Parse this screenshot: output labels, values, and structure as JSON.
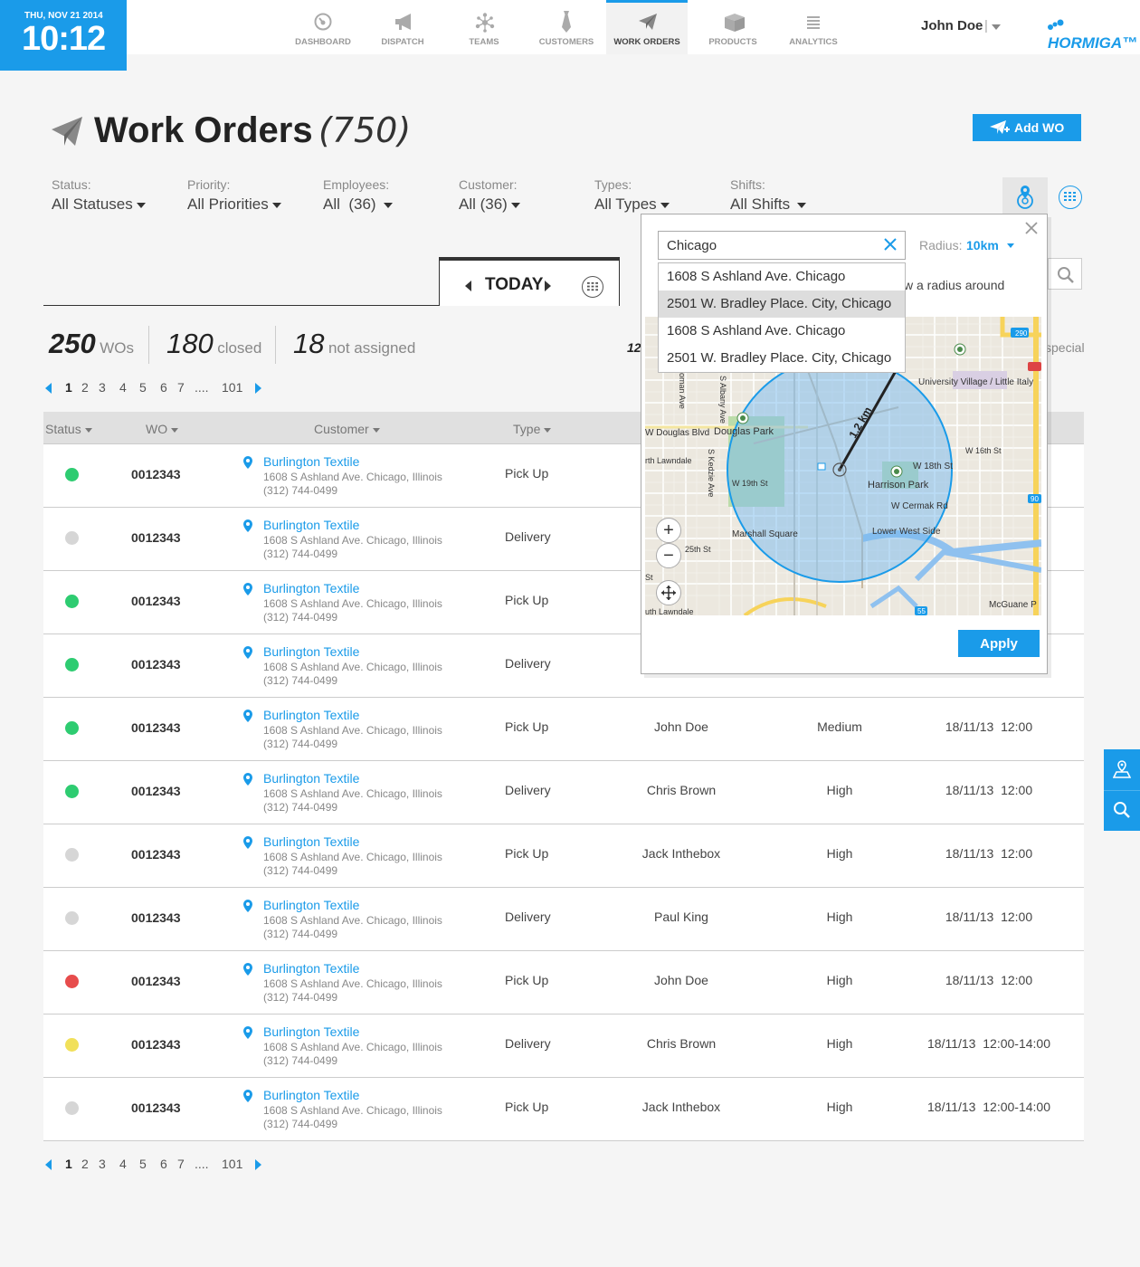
{
  "clock": {
    "date": "THU, NOV 21 2014",
    "time": "10:12"
  },
  "nav": [
    {
      "label": "DASHBOARD",
      "icon": "dashboard-icon"
    },
    {
      "label": "DISPATCH",
      "icon": "megaphone-icon"
    },
    {
      "label": "TEAMS",
      "icon": "teams-icon"
    },
    {
      "label": "CUSTOMERS",
      "icon": "tie-icon"
    },
    {
      "label": "WORK ORDERS",
      "icon": "paper-plane-icon",
      "active": true
    },
    {
      "label": "PRODUCTS",
      "icon": "box-icon"
    },
    {
      "label": "ANALYTICS",
      "icon": "list-icon"
    }
  ],
  "user": {
    "name": "John Doe",
    "separator": "|"
  },
  "brand": {
    "logo": "HORMIGA™",
    "accent": "#1a9be9"
  },
  "page": {
    "title": "Work Orders",
    "count": "(750)",
    "add_label": "Add WO"
  },
  "filters": [
    {
      "label": "Status:",
      "value": "All Statuses"
    },
    {
      "label": "Priority:",
      "value": "All Priorities"
    },
    {
      "label": "Employees:",
      "value": "All  (36)"
    },
    {
      "label": "Customer:",
      "value": "All (36)"
    },
    {
      "label": "Types:",
      "value": "All Types"
    },
    {
      "label": "Shifts:",
      "value": "All Shifts"
    }
  ],
  "day": {
    "label": "TODAY"
  },
  "stats": {
    "wos": "250",
    "wos_label": "WOs",
    "closed": "180",
    "closed_label": "closed",
    "unassigned": "18",
    "unassigned_label": "not assigned",
    "partial_left": "12",
    "partial_right": "special"
  },
  "pager": {
    "pages": [
      "1",
      "2",
      "3",
      "4",
      "5",
      "6",
      "7",
      "....",
      "101"
    ],
    "current": "1"
  },
  "table": {
    "headers": [
      "Status",
      "WO",
      "Customer",
      "Type"
    ],
    "rows": [
      {
        "status": "#2ecc71",
        "wo": "0012343",
        "customer": "Burlington Textile",
        "address": "1608 S Ashland Ave. Chicago, Illinois",
        "phone": "(312) 744-0499",
        "type": "Pick Up",
        "employee": "",
        "priority": "",
        "date": ""
      },
      {
        "status": "#d6d6d6",
        "wo": "0012343",
        "customer": "Burlington Textile",
        "address": "1608 S Ashland Ave. Chicago, Illinois",
        "phone": "(312) 744-0499",
        "type": "Delivery",
        "employee": "",
        "priority": "",
        "date": ""
      },
      {
        "status": "#2ecc71",
        "wo": "0012343",
        "customer": "Burlington Textile",
        "address": "1608 S Ashland Ave. Chicago, Illinois",
        "phone": "(312) 744-0499",
        "type": "Pick Up",
        "employee": "",
        "priority": "",
        "date": ""
      },
      {
        "status": "#2ecc71",
        "wo": "0012343",
        "customer": "Burlington Textile",
        "address": "1608 S Ashland Ave. Chicago, Illinois",
        "phone": "(312) 744-0499",
        "type": "Delivery",
        "employee": "",
        "priority": "",
        "date": ""
      },
      {
        "status": "#2ecc71",
        "wo": "0012343",
        "customer": "Burlington Textile",
        "address": "1608 S Ashland Ave. Chicago, Illinois",
        "phone": "(312) 744-0499",
        "type": "Pick Up",
        "employee": "John Doe",
        "priority": "Medium",
        "date": "18/11/13  12:00"
      },
      {
        "status": "#2ecc71",
        "wo": "0012343",
        "customer": "Burlington Textile",
        "address": "1608 S Ashland Ave. Chicago, Illinois",
        "phone": "(312) 744-0499",
        "type": "Delivery",
        "employee": "Chris Brown",
        "priority": "High",
        "date": "18/11/13  12:00"
      },
      {
        "status": "#d6d6d6",
        "wo": "0012343",
        "customer": "Burlington Textile",
        "address": "1608 S Ashland Ave. Chicago, Illinois",
        "phone": "(312) 744-0499",
        "type": "Pick Up",
        "employee": "Jack Inthebox",
        "priority": "High",
        "date": "18/11/13  12:00"
      },
      {
        "status": "#d6d6d6",
        "wo": "0012343",
        "customer": "Burlington Textile",
        "address": "1608 S Ashland Ave. Chicago, Illinois",
        "phone": "(312) 744-0499",
        "type": "Delivery",
        "employee": "Paul King",
        "priority": "High",
        "date": "18/11/13  12:00"
      },
      {
        "status": "#e74c4c",
        "wo": "0012343",
        "customer": "Burlington Textile",
        "address": "1608 S Ashland Ave. Chicago, Illinois",
        "phone": "(312) 744-0499",
        "type": "Pick Up",
        "employee": "John Doe",
        "priority": "High",
        "date": "18/11/13  12:00"
      },
      {
        "status": "#f1e05a",
        "wo": "0012343",
        "customer": "Burlington Textile",
        "address": "1608 S Ashland Ave. Chicago, Illinois",
        "phone": "(312) 744-0499",
        "type": "Delivery",
        "employee": "Chris Brown",
        "priority": "High",
        "date": "18/11/13  12:00-14:00"
      },
      {
        "status": "#d6d6d6",
        "wo": "0012343",
        "customer": "Burlington Textile",
        "address": "1608 S Ashland Ave. Chicago, Illinois",
        "phone": "(312) 744-0499",
        "type": "Pick Up",
        "employee": "Jack Inthebox",
        "priority": "High",
        "date": "18/11/13  12:00-14:00"
      }
    ]
  },
  "popup": {
    "location_value": "Chicago",
    "radius_label": "Radius:",
    "radius_value": "10km",
    "hint": "w a radius around",
    "suggestions": [
      "1608 S Ashland Ave. Chicago",
      "2501 W. Bradley Place. City, Chicago",
      "1608 S Ashland Ave. Chicago",
      "2501 W. Bradley Place. City, Chicago"
    ],
    "selected_suggestion": 1,
    "map_labels": {
      "distance": "1.2 km",
      "douglas_park": "Douglas Park",
      "douglas_blvd": "W Douglas Blvd",
      "harrison_park": "Harrison Park",
      "w18th_st": "W 18th St",
      "w16th_st": "W 16th St",
      "w19th_st": "W 19th St",
      "cermak": "W Cermak Rd",
      "marshall_square": "Marshall Square",
      "lower_west_side": "Lower West Side",
      "university_village": "University Village / Little Italy",
      "lawndale": "rth Lawndale",
      "south_lawndale": "uth Lawndale",
      "w25th_st": "25th St",
      "kedzie": "S Kedzie Ave",
      "albany": "S Albany Ave",
      "mcguane": "McGuane P",
      "human_ave": "oman Ave",
      "st_frag": "St",
      "hwy290": "290",
      "hwy55": "55",
      "hwy90": "90"
    },
    "apply_label": "Apply"
  }
}
